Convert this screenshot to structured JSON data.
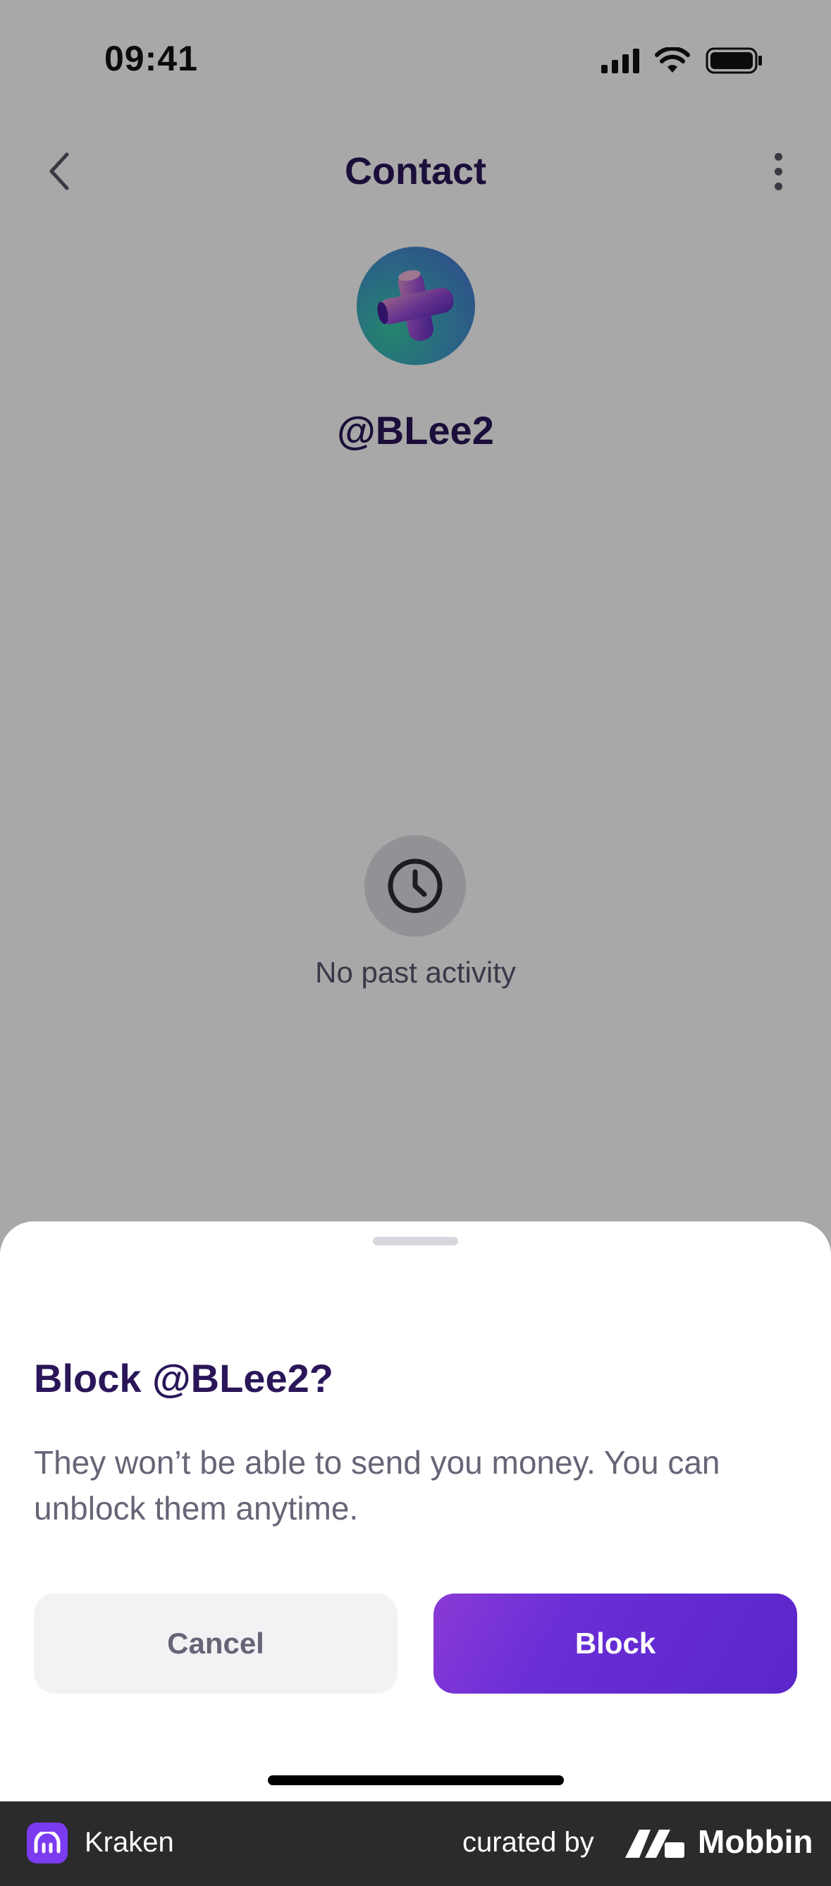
{
  "status_bar": {
    "time": "09:41"
  },
  "header": {
    "title": "Contact"
  },
  "contact": {
    "username": "@BLee2"
  },
  "activity": {
    "empty_text": "No past activity"
  },
  "sheet": {
    "title": "Block @BLee2?",
    "body": "They won’t be able to send you money. You can unblock them anytime.",
    "cancel_label": "Cancel",
    "block_label": "Block"
  },
  "footer": {
    "app_name": "Kraken",
    "curated_label": "curated by",
    "brand": "Mobbin"
  },
  "colors": {
    "accent": "#6a2ed6",
    "title": "#2a1659",
    "body_text": "#686477"
  }
}
